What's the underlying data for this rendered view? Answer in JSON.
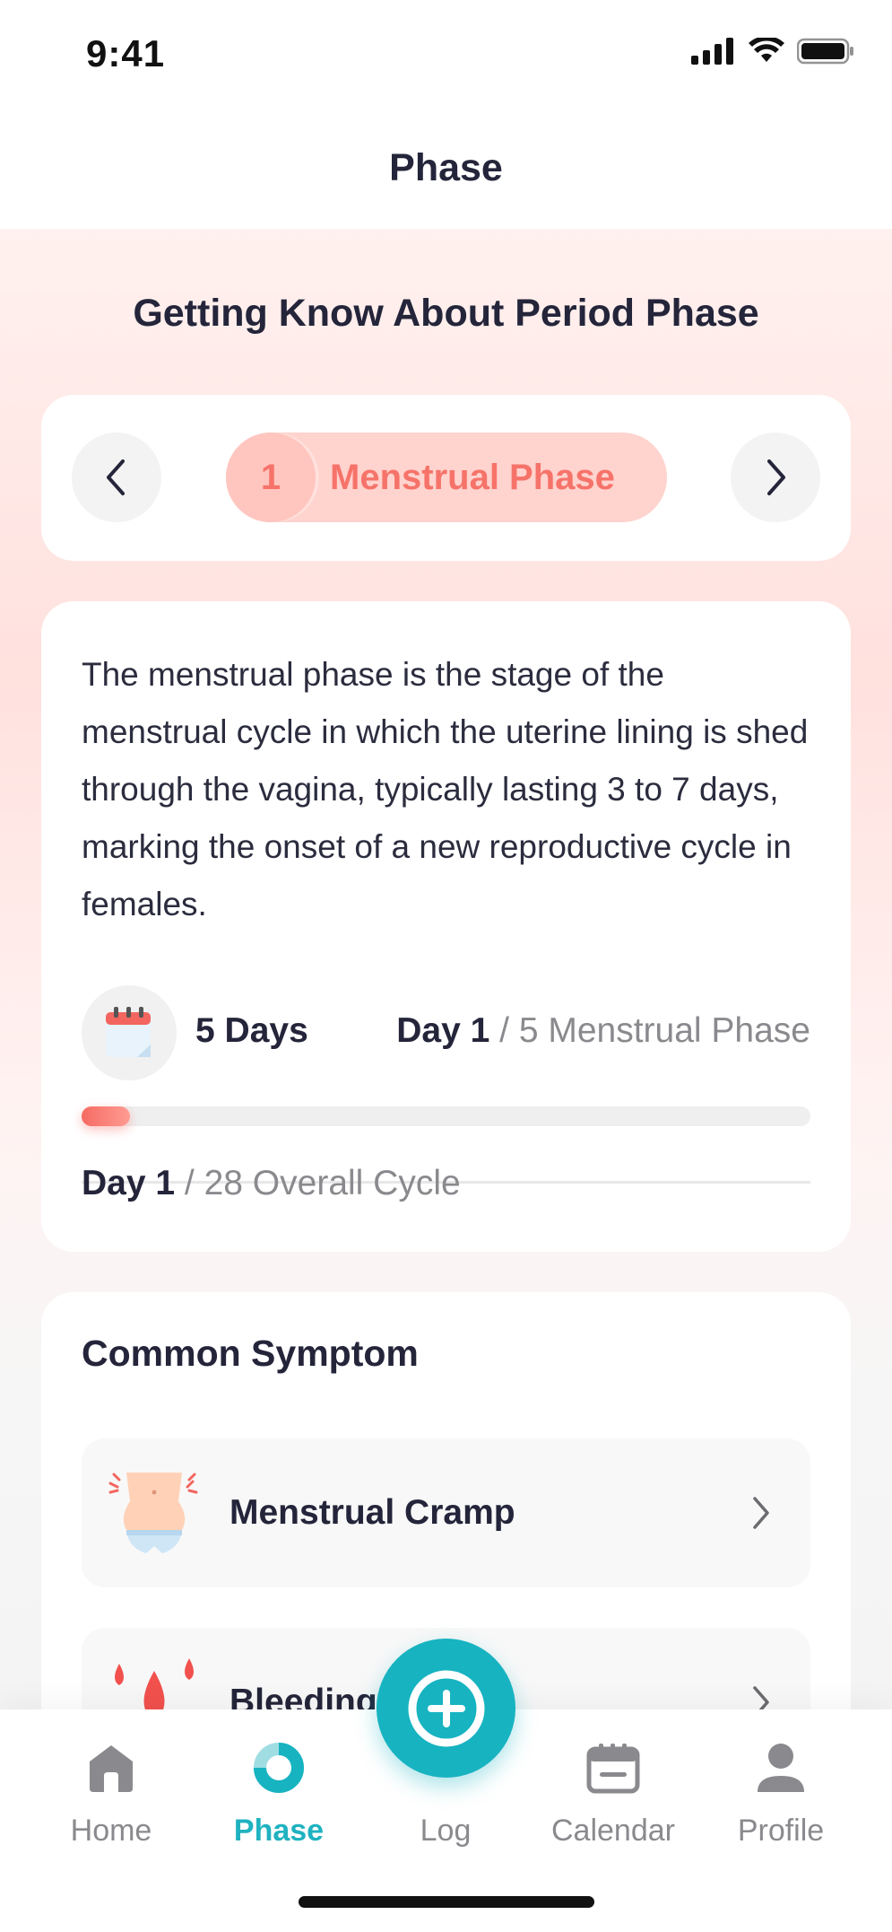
{
  "status_bar": {
    "time": "9:41"
  },
  "header": {
    "title": "Phase"
  },
  "content": {
    "heading": "Getting Know About Period Phase",
    "phase_selector": {
      "number": "1",
      "name": "Menstrual Phase"
    },
    "info": {
      "description": "The menstrual phase is the stage of the menstrual cycle in which the uterine lining is shed through the vagina, typically lasting 3 to 7 days, marking the onset of a new reproductive cycle in females.",
      "duration": "5 Days",
      "phase_day_current": "Day 1",
      "phase_day_rest": " / 5 Menstrual Phase",
      "phase_progress_fraction": 0.067,
      "overall_day_current": "Day 1",
      "overall_day_rest": " / 28 Overall Cycle"
    },
    "symptoms": {
      "title": "Common Symptom",
      "items": [
        {
          "label": "Menstrual Cramp",
          "icon": "waist-cramp-icon"
        },
        {
          "label": "Bleeding",
          "icon": "blood-drops-icon"
        }
      ]
    }
  },
  "tab_bar": {
    "items": [
      {
        "label": "Home",
        "icon": "home-icon"
      },
      {
        "label": "Phase",
        "icon": "phase-ring-icon",
        "active": true
      },
      {
        "label": "Log",
        "icon": "plus-icon"
      },
      {
        "label": "Calendar",
        "icon": "calendar-icon"
      },
      {
        "label": "Profile",
        "icon": "person-icon"
      }
    ]
  },
  "colors": {
    "accent": "#17b3c1",
    "phase_text": "#f6736a",
    "phase_pill": "#ffd3ce",
    "title_text": "#24253a"
  }
}
